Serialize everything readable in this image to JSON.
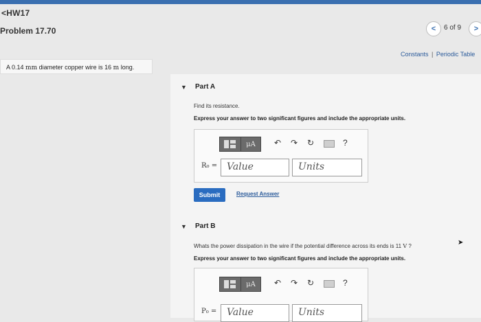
{
  "nav": {
    "back_label": "HW17"
  },
  "problem": {
    "title": "Problem 17.70"
  },
  "pager": {
    "prev_icon": "chevron-left",
    "count": "6 of 9",
    "next_icon": "chevron-right"
  },
  "top_links": {
    "constants": "Constants",
    "separator": "|",
    "periodic": "Periodic Table"
  },
  "intro": {
    "pre": "A 0.14 ",
    "unit1": "mm",
    "mid": " diameter copper wire is 16 ",
    "unit2": "m",
    "post": " long."
  },
  "part_a": {
    "header": "Part A",
    "question": "Find its resistance.",
    "instructions": "Express your answer to two significant figures and include the appropriate units.",
    "label": "R₀ =",
    "value_placeholder": "Value",
    "units_placeholder": "Units",
    "submit_label": "Submit",
    "request_label": "Request Answer",
    "mu_label": "μA",
    "help": "?"
  },
  "part_b": {
    "header": "Part B",
    "question_pre": "Whats the power dissipation in the wire if the potential difference across its ends is 11 ",
    "question_unit": "V",
    "question_post": " ?",
    "instructions": "Express your answer to two significant figures and include the appropriate units.",
    "label": "P₀ =",
    "value_placeholder": "Value",
    "units_placeholder": "Units",
    "mu_label": "μA",
    "help": "?"
  },
  "colors": {
    "accent": "#2a6cc0",
    "link": "#2a5a9a"
  }
}
